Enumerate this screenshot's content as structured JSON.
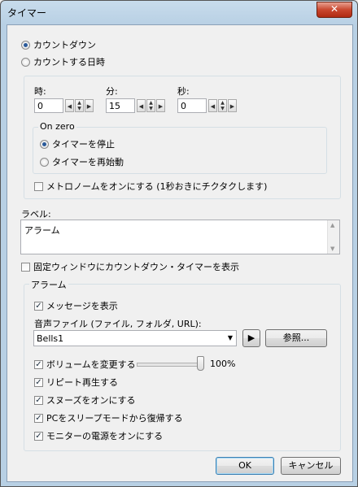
{
  "window": {
    "title": "タイマー",
    "close_glyph": "✕"
  },
  "mode": {
    "countdown_label": "カウントダウン",
    "countdown_selected": true,
    "datetime_label": "カウントする日時",
    "datetime_selected": false
  },
  "time": {
    "hours_label": "時:",
    "hours_value": "0",
    "minutes_label": "分:",
    "minutes_value": "15",
    "seconds_label": "秒:",
    "seconds_value": "0"
  },
  "on_zero": {
    "group_label": "On zero",
    "stop_label": "タイマーを停止",
    "stop_selected": true,
    "restart_label": "タイマーを再始動",
    "restart_selected": false
  },
  "metronome": {
    "label": "メトロノームをオンにする (1秒おきにチクタクします)",
    "checked": false
  },
  "label_field": {
    "caption": "ラベル:",
    "value": "アラーム"
  },
  "fixed_window": {
    "label": "固定ウィンドウにカウントダウン・タイマーを表示",
    "checked": false
  },
  "alarm": {
    "group_label": "アラーム",
    "show_message": {
      "label": "メッセージを表示",
      "checked": true
    },
    "sound_file_label": "音声ファイル (ファイル, フォルダ, URL):",
    "sound_file_value": "Bells1",
    "play_glyph": "▶",
    "browse_label": "参照...",
    "change_volume": {
      "label": "ボリュームを変更する",
      "checked": true
    },
    "volume_percent": "100%",
    "volume_level": 1.0,
    "repeat": {
      "label": "リピート再生する",
      "checked": true
    },
    "snooze": {
      "label": "スヌーズをオンにする",
      "checked": true
    },
    "wake_pc": {
      "label": "PCをスリープモードから復帰する",
      "checked": true
    },
    "monitor_on": {
      "label": "モニターの電源をオンにする",
      "checked": true
    }
  },
  "buttons": {
    "ok": "OK",
    "cancel": "キャンセル"
  },
  "icons": {
    "checkmark": "✓",
    "arrow_left": "◀",
    "arrow_right": "▶",
    "arrow_up": "▲",
    "arrow_down": "▼"
  }
}
